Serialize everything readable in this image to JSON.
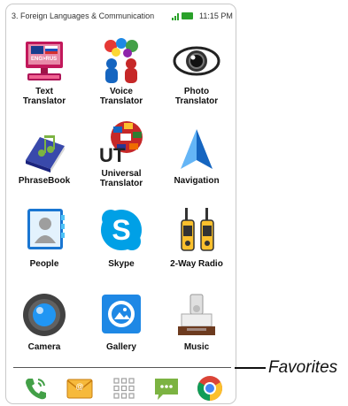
{
  "status_bar": {
    "title": "3. Foreign Languages & Communication",
    "time": "11:15 PM"
  },
  "apps": [
    {
      "label": "Text\nTranslator",
      "icon": "text-translator-icon",
      "badge": "ENG>RUS"
    },
    {
      "label": "Voice\nTranslator",
      "icon": "voice-translator-icon"
    },
    {
      "label": "Photo\nTranslator",
      "icon": "photo-translator-icon"
    },
    {
      "label": "PhraseBook",
      "icon": "phrasebook-icon"
    },
    {
      "label": "Universal\nTranslator",
      "icon": "universal-translator-icon",
      "badge": "UT"
    },
    {
      "label": "Navigation",
      "icon": "navigation-icon"
    },
    {
      "label": "People",
      "icon": "people-icon"
    },
    {
      "label": "Skype",
      "icon": "skype-icon"
    },
    {
      "label": "2-Way Radio",
      "icon": "two-way-radio-icon"
    },
    {
      "label": "Camera",
      "icon": "camera-icon"
    },
    {
      "label": "Gallery",
      "icon": "gallery-icon"
    },
    {
      "label": "Music",
      "icon": "music-icon"
    }
  ],
  "dock": [
    {
      "icon": "phone-icon"
    },
    {
      "icon": "email-icon"
    },
    {
      "icon": "app-drawer-icon"
    },
    {
      "icon": "messaging-icon"
    },
    {
      "icon": "chrome-icon"
    }
  ],
  "callout": {
    "label": "Favorites"
  },
  "colors": {
    "accent_blue": "#2b7fd6",
    "status_green": "#2aa12a"
  }
}
